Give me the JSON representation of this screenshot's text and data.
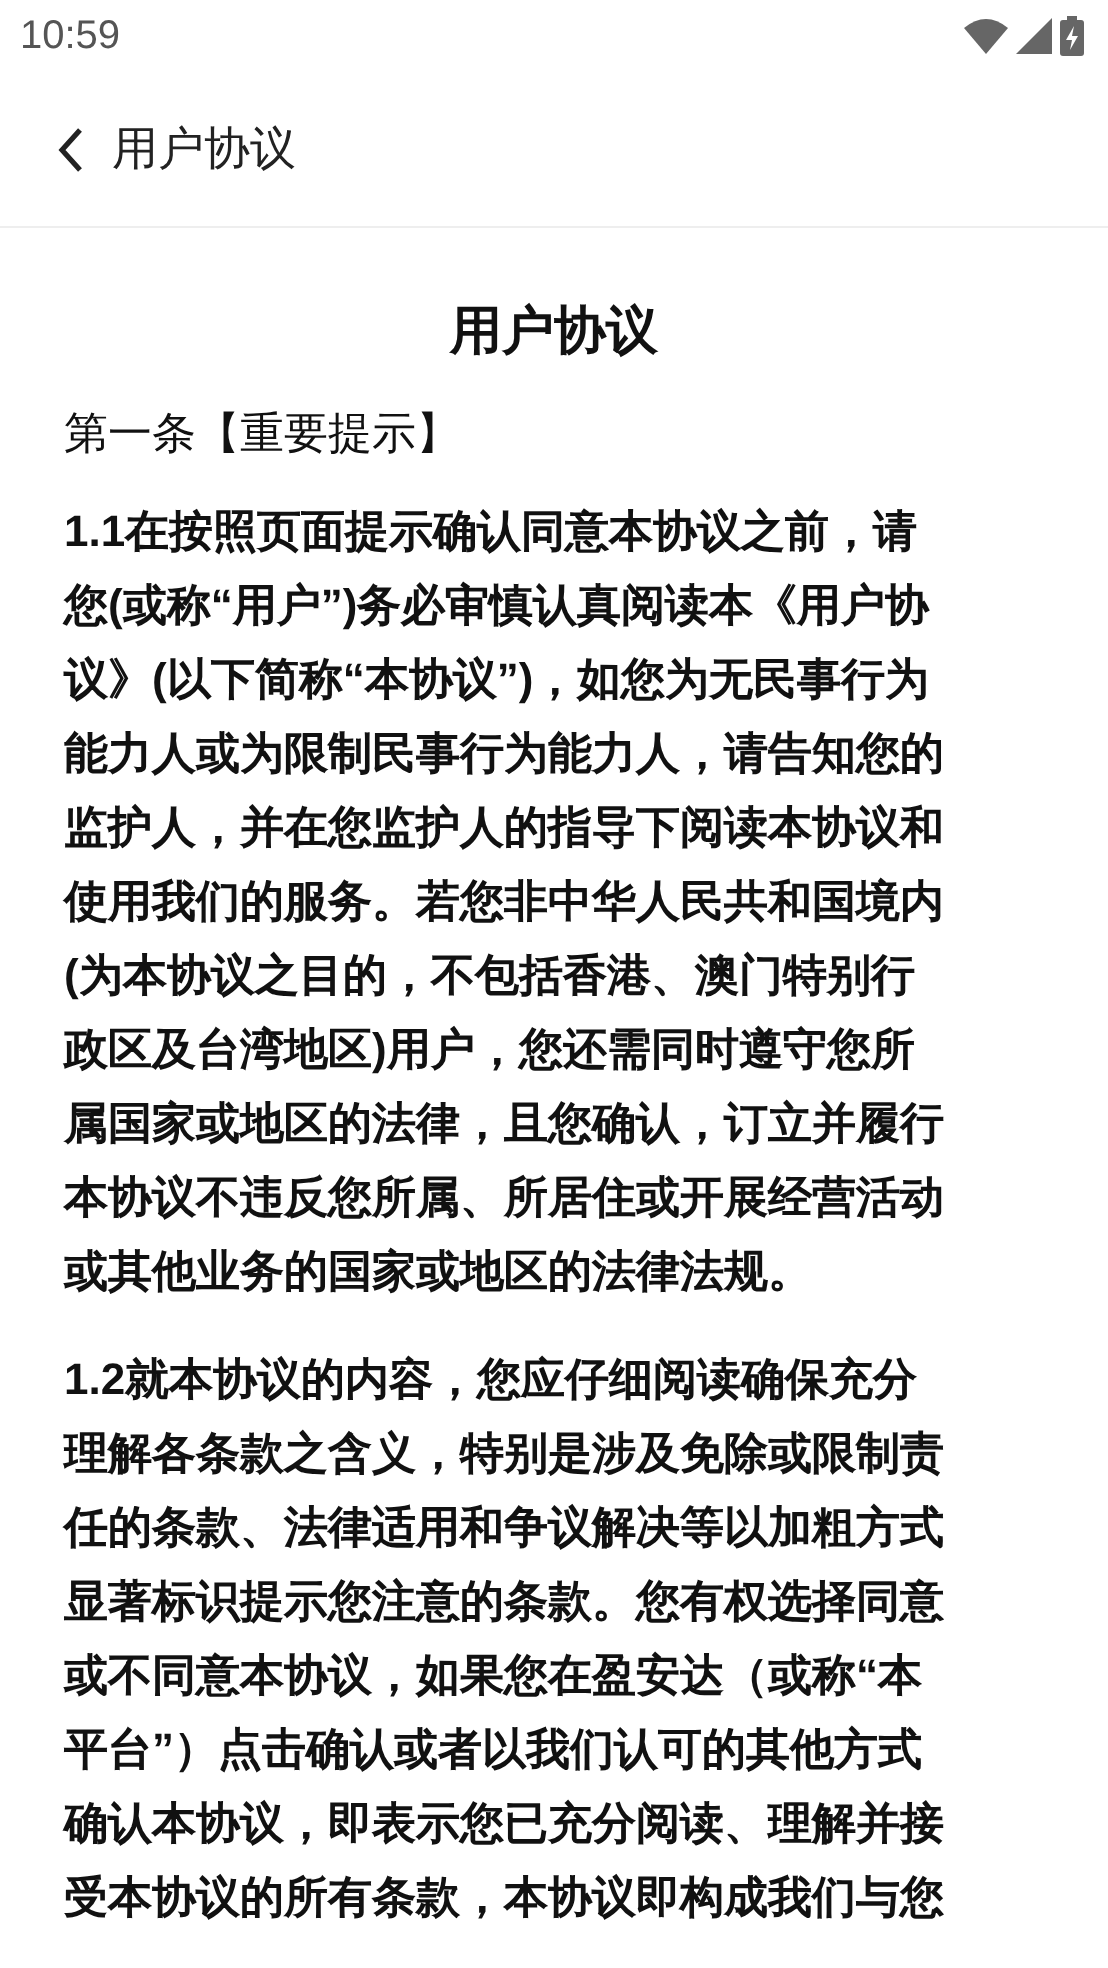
{
  "status_bar": {
    "time": "10:59"
  },
  "header": {
    "title": "用户协议"
  },
  "document": {
    "title": "用户协议",
    "section_heading": "第一条【重要提示】",
    "paragraphs": [
      {
        "lines": [
          "1.1在按照页面提示确认同意本协议之前，请",
          "您(或称“用户”)务必审慎认真阅读本《用户协",
          "议》(以下简称“本协议”)，如您为无民事行为",
          "能力人或为限制民事行为能力人，请告知您的",
          "监护人，并在您监护人的指导下阅读本协议和",
          "使用我们的服务。若您非中华人民共和国境内",
          "(为本协议之目的，不包括香港、澳门特别行",
          "政区及台湾地区)用户，您还需同时遵守您所",
          "属国家或地区的法律，且您确认，订立并履行",
          "本协议不违反您所属、所居住或开展经营活动",
          "或其他业务的国家或地区的法律法规。"
        ]
      },
      {
        "lines": [
          "1.2就本协议的内容，您应仔细阅读确保充分",
          "理解各条款之含义，特别是涉及免除或限制责",
          "任的条款、法律适用和争议解决等以加粗方式",
          "显著标识提示您注意的条款。您有权选择同意",
          "或不同意本协议，如果您在盈安达（或称“本",
          "平台”）点击确认或者以我们认可的其他方式",
          "确认本协议，即表示您已充分阅读、理解并接",
          "受本协议的所有条款，本协议即构成我们与您"
        ]
      }
    ]
  }
}
